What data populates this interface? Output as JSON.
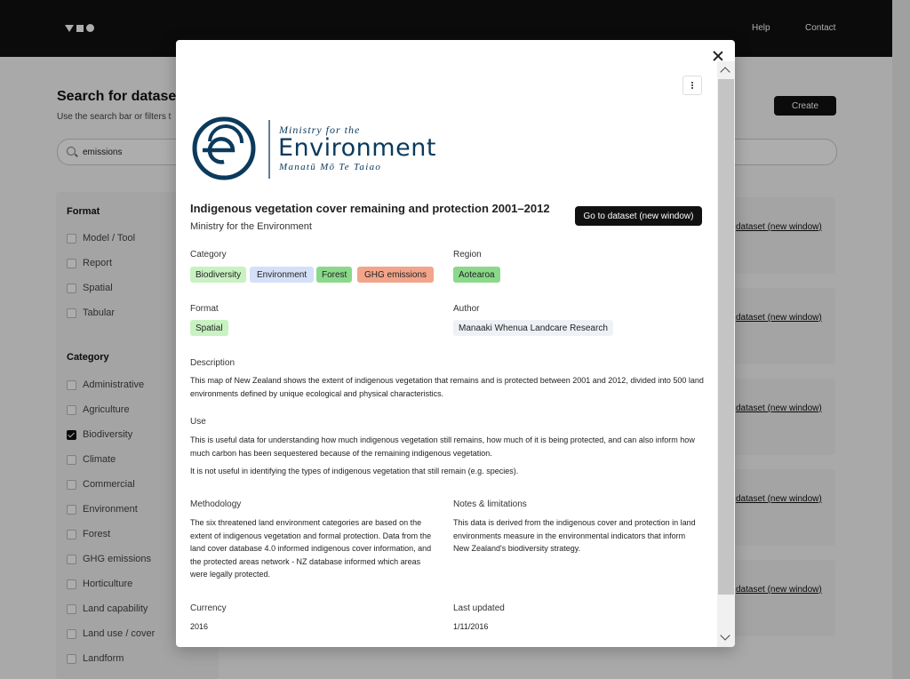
{
  "colors": {
    "tag_green": "#c9f2c2",
    "tag_blue": "#d4e0f7",
    "tag_forest": "#8ad98a",
    "tag_orange": "#f2a58a",
    "tag_grey": "#eef1f5",
    "brand_navy": "#0b3a5d"
  },
  "header": {
    "logo_icon": "triangle-square-circle-logo",
    "nav": [
      "Help",
      "Contact"
    ]
  },
  "page": {
    "title": "Search for datasets,",
    "subtitle": "Use the search bar or filters t",
    "create_label": "Create",
    "search": {
      "value": "emissions",
      "icon": "search-icon"
    }
  },
  "filters": {
    "format": {
      "heading": "Format",
      "items": [
        {
          "label": "Model / Tool",
          "checked": false
        },
        {
          "label": "Report",
          "checked": false
        },
        {
          "label": "Spatial",
          "checked": false
        },
        {
          "label": "Tabular",
          "checked": false
        }
      ]
    },
    "category": {
      "heading": "Category",
      "items": [
        {
          "label": "Administrative",
          "checked": false
        },
        {
          "label": "Agriculture",
          "checked": false
        },
        {
          "label": "Biodiversity",
          "checked": true
        },
        {
          "label": "Climate",
          "checked": false
        },
        {
          "label": "Commercial",
          "checked": false
        },
        {
          "label": "Environment",
          "checked": false
        },
        {
          "label": "Forest",
          "checked": false
        },
        {
          "label": "GHG emissions",
          "checked": false
        },
        {
          "label": "Horticulture",
          "checked": false
        },
        {
          "label": "Land capability",
          "checked": false
        },
        {
          "label": "Land use / cover",
          "checked": false
        },
        {
          "label": "Landform",
          "checked": false
        }
      ]
    }
  },
  "results": [
    {
      "link": "dataset (new window)"
    },
    {
      "link": "dataset (new window)"
    },
    {
      "link": "dataset (new window)"
    },
    {
      "link": "dataset (new window)"
    },
    {
      "link": "dataset (new window)"
    }
  ],
  "modal": {
    "logo": {
      "line1": "Ministry for the",
      "line2": "Environment",
      "line3": "Manatū Mō Te Taiao"
    },
    "title": "Indigenous vegetation cover remaining and protection 2001–2012",
    "publisher": "Ministry for the Environment",
    "goto_label": "Go to dataset (new window)",
    "category_label": "Category",
    "categories": [
      "Biodiversity",
      "Environment",
      "Forest",
      "GHG emissions"
    ],
    "region_label": "Region",
    "region": "Aotearoa",
    "format_label": "Format",
    "format": "Spatial",
    "author_label": "Author",
    "author": "Manaaki Whenua Landcare Research",
    "description_label": "Description",
    "description": "This map of New Zealand shows the extent of indigenous vegetation that remains and is protected between 2001 and 2012, divided into 500 land environments defined by unique ecological and physical characteristics.",
    "use_label": "Use",
    "use_1": "This is useful data for understanding how much indigenous vegetation still remains, how much of it is being protected, and can also inform how much carbon has been sequestered because of the remaining indigenous vegetation.",
    "use_2": "It is not useful in identifying the types of indigenous vegetation that still remain (e.g. species).",
    "methodology_label": "Methodology",
    "methodology": "The six threatened land environment categories are based on the extent of indigenous vegetation and formal protection. Data from the land cover database 4.0 informed indigenous cover information, and the protected areas network - NZ database informed which areas were legally protected.",
    "notes_label": "Notes & limitations",
    "notes": "This data is derived from the indigenous cover and protection in land environments measure in the environmental indicators that inform New Zealand's biodiversity strategy.",
    "currency_label": "Currency",
    "currency": "2016",
    "updated_label": "Last updated",
    "updated": "1/11/2016"
  }
}
